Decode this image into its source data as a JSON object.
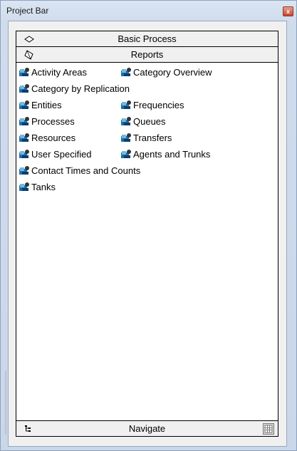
{
  "window": {
    "title": "Project Bar",
    "close_label": "x"
  },
  "panels": {
    "basic_process": {
      "label": "Basic Process",
      "icon": "diamond-icon"
    },
    "reports": {
      "label": "Reports",
      "icon": "diamond-tilted-icon"
    }
  },
  "reports_items": [
    {
      "label": "Activity Areas",
      "icon": "report-icon"
    },
    {
      "label": "Category Overview",
      "icon": "report-icon"
    },
    {
      "label": "Category by Replication",
      "icon": "report-icon"
    },
    {
      "label": "Entities",
      "icon": "report-icon"
    },
    {
      "label": "Frequencies",
      "icon": "report-icon"
    },
    {
      "label": "Processes",
      "icon": "report-icon"
    },
    {
      "label": "Queues",
      "icon": "report-icon"
    },
    {
      "label": "Resources",
      "icon": "report-icon"
    },
    {
      "label": "Transfers",
      "icon": "report-icon"
    },
    {
      "label": "User Specified",
      "icon": "report-icon"
    },
    {
      "label": "Agents and Trunks",
      "icon": "report-icon"
    },
    {
      "label": "Contact Times and Counts",
      "icon": "report-icon"
    },
    {
      "label": "Tanks",
      "icon": "report-icon"
    }
  ],
  "footer": {
    "navigate_label": "Navigate",
    "tree_icon": "tree-icon",
    "nav_button_icon": "grid-window-icon"
  }
}
